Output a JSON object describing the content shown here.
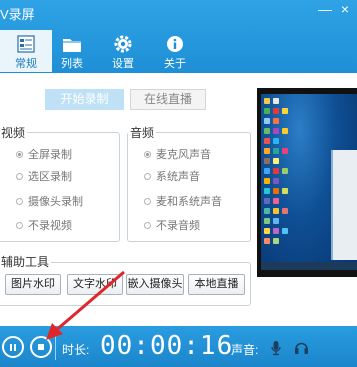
{
  "window": {
    "title": "V录屏",
    "controls": [
      "—",
      "×"
    ]
  },
  "nav": [
    {
      "label": "常规",
      "icon": "settings-sheet-icon",
      "active": true
    },
    {
      "label": "列表",
      "icon": "folder-icon",
      "active": false
    },
    {
      "label": "设置",
      "icon": "gear-icon",
      "active": false
    },
    {
      "label": "关于",
      "icon": "info-icon",
      "active": false
    }
  ],
  "actions": {
    "start_label": "开始录制",
    "live_label": "在线直播"
  },
  "video_group": {
    "title": "视频",
    "options": [
      "全屏录制",
      "选区录制",
      "摄像头录制",
      "不录视频"
    ],
    "selected": "全屏录制"
  },
  "audio_group": {
    "title": "音频",
    "options": [
      "麦克风声音",
      "系统声音",
      "麦和系统声音",
      "不录音频"
    ],
    "selected": "麦克风声音"
  },
  "tools_group": {
    "title": "辅助工具",
    "buttons": [
      "图片水印",
      "文字水印",
      "嵌入摄像头",
      "本地直播"
    ]
  },
  "bottom_bar": {
    "duration_label": "时长:",
    "timer": "00:00:16",
    "volume_label": "声音:"
  },
  "colors": {
    "header_blue": "#2fa3e6",
    "bottom_blue": "#2a9ce0",
    "annotation_red": "#e0262a"
  }
}
